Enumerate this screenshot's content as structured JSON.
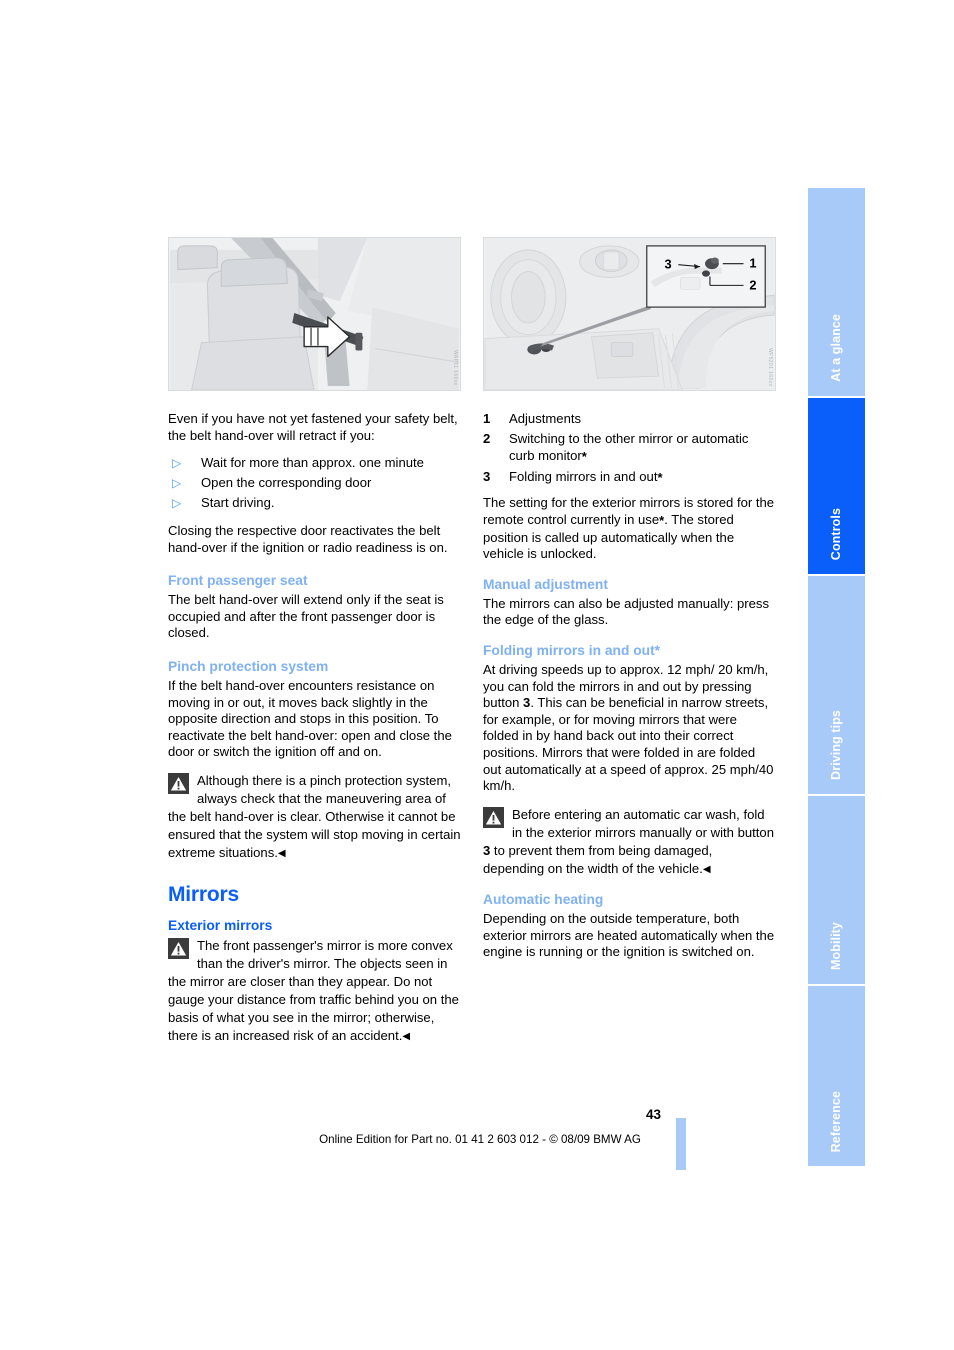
{
  "sidebar": {
    "tabs": [
      {
        "label": "At a glance",
        "active": false
      },
      {
        "label": "Controls",
        "active": true
      },
      {
        "label": "Driving tips",
        "active": false
      },
      {
        "label": "Mobility",
        "active": false
      },
      {
        "label": "Reference",
        "active": false
      }
    ]
  },
  "colors": {
    "heading_blue": "#0a5ffb",
    "subheading_light_blue": "#7fb1f3",
    "tab_inactive": "#a8caf8",
    "tab_active": "#0a5ffb",
    "bullet_blue": "#4d9bf5"
  },
  "left_column": {
    "figure": {
      "alt": "Car seat with safety belt hand-over arm and white arrow indicating movement",
      "code": "WAP11 160xx"
    },
    "intro_paragraph": "Even if you have not yet fastened your safety belt, the belt hand-over will retract if you:",
    "bullets": [
      "Wait for more than approx. one minute",
      "Open the corresponding door",
      "Start driving."
    ],
    "after_bullets": "Closing the respective door reactivates the belt hand-over if the ignition or radio readiness is on.",
    "front_passenger_seat": {
      "heading": "Front passenger seat",
      "body": "The belt hand-over will extend only if the seat is occupied and after the front passenger door is closed."
    },
    "pinch_protection": {
      "heading": "Pinch protection system",
      "body": "If the belt hand-over encounters resistance on moving in or out, it moves back slightly in the opposite direction and stops in this position. To reactivate the belt hand-over: open and close the door or switch the ignition off and on.",
      "warning": "Although there is a pinch protection system, always check that the maneuvering area of the belt hand-over is clear. Otherwise it cannot be ensured that the system will stop moving in certain extreme situations."
    },
    "mirrors_title": "Mirrors",
    "exterior_mirrors": {
      "heading": "Exterior mirrors",
      "warning": "The front passenger's mirror is more convex than the driver's mirror. The objects seen in the mirror are closer than they appear. Do not gauge your distance from traffic behind you on the basis of what you see in the mirror; otherwise, there is an increased risk of an accident."
    }
  },
  "right_column": {
    "figure": {
      "alt": "Driver door panel with exterior mirror control buttons and magnified callout",
      "code": "WF5201 160xx",
      "callout_labels": [
        "1",
        "2",
        "3"
      ]
    },
    "legend": [
      {
        "num": "1",
        "text": "Adjustments",
        "asterisk": false
      },
      {
        "num": "2",
        "text": "Switching to the other mirror or automatic curb monitor",
        "asterisk": true
      },
      {
        "num": "3",
        "text": "Folding mirrors in and out",
        "asterisk": true
      }
    ],
    "legend_body_1": "The setting for the exterior mirrors is stored for the remote control currently in use",
    "legend_body_2": ". The stored position is called up automatically when the vehicle is unlocked.",
    "manual_adjustment": {
      "heading": "Manual adjustment",
      "body": "The mirrors can also be adjusted manually: press the edge of the glass."
    },
    "folding_mirrors": {
      "heading": "Folding mirrors in and out*",
      "body_part1": "At driving speeds up to approx. 12 mph/ 20 km/h, you can fold the mirrors in and out by pressing button ",
      "body_button": "3",
      "body_part2": ". This can be beneficial in narrow streets, for example, or for moving mirrors that were folded in by hand back out into their correct positions. Mirrors that were folded in are folded out automatically at a speed of approx. 25 mph/40 km/h.",
      "warning_part1": "Before entering an automatic car wash, fold in the exterior mirrors manually or with button ",
      "warning_button": "3",
      "warning_part2": " to prevent them from being damaged, depending on the width of the vehicle."
    },
    "automatic_heating": {
      "heading": "Automatic heating",
      "body": "Depending on the outside temperature, both exterior mirrors are heated automatically when the engine is running or the ignition is switched on."
    }
  },
  "footer": {
    "page_number": "43",
    "edition_line": "Online Edition for Part no. 01 41 2 603 012 - © 08/09 BMW AG"
  }
}
